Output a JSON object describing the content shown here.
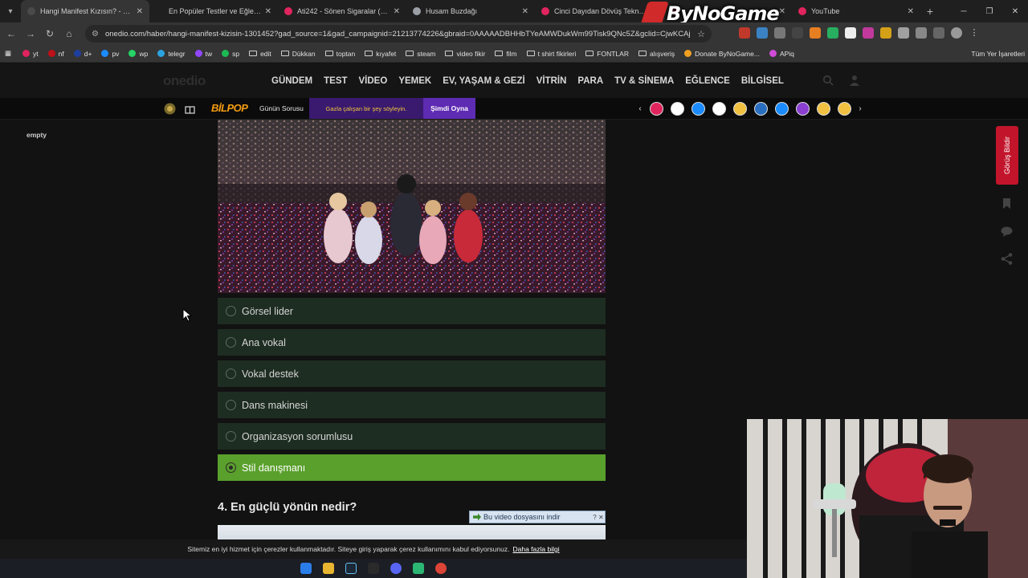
{
  "browser": {
    "tabs": [
      {
        "label": "Hangi Manifest Kızısın? - Onedio",
        "active": true,
        "fav_color": "#4a4a4a"
      },
      {
        "label": "En Popüler Testler ve Eğlenceli T",
        "active": false,
        "fav_color": "#1f1f1f"
      },
      {
        "label": "Ati242 - Sönen Sigaralar (Official",
        "active": false,
        "fav_color": "#e0245e"
      },
      {
        "label": "Husam Buzdağı",
        "active": false,
        "fav_color": "#9aa0a6"
      },
      {
        "label": "Cinci Dayıdan Dövüş Teknikleri",
        "active": false,
        "fav_color": "#e0245e"
      },
      {
        "label": "",
        "active": false,
        "fav_color": "#e0245e"
      },
      {
        "label": "YouTube",
        "active": false,
        "fav_color": "#e0245e"
      }
    ],
    "watermark_text": "ByNoGame",
    "url": "onedio.com/haber/hangi-manifest-kizisin-1301452?gad_source=1&gad_campaignid=21213774226&gbraid=0AAAAADBHHbTYeAMWDukWm99Tisk9QNc5Z&gclid=CjwKCAj...",
    "bookmarks": [
      {
        "label": "yt",
        "type": "site",
        "color": "#e0245e"
      },
      {
        "label": "nf",
        "type": "site",
        "color": "#c0101a"
      },
      {
        "label": "d+",
        "type": "site",
        "color": "#1f3f9e"
      },
      {
        "label": "pv",
        "type": "site",
        "color": "#1a8cff"
      },
      {
        "label": "wp",
        "type": "site",
        "color": "#25d366"
      },
      {
        "label": "telegr",
        "type": "site",
        "color": "#2aa3e0"
      },
      {
        "label": "tw",
        "type": "site",
        "color": "#9146ff"
      },
      {
        "label": "sp",
        "type": "site",
        "color": "#1db954"
      },
      {
        "label": "edit",
        "type": "folder"
      },
      {
        "label": "Dükkan",
        "type": "folder"
      },
      {
        "label": "toptan",
        "type": "folder"
      },
      {
        "label": "kıyafet",
        "type": "folder"
      },
      {
        "label": "steam",
        "type": "folder"
      },
      {
        "label": "video fikir",
        "type": "folder"
      },
      {
        "label": "film",
        "type": "folder"
      },
      {
        "label": "t shirt fikirleri",
        "type": "folder"
      },
      {
        "label": "FONTLAR",
        "type": "folder"
      },
      {
        "label": "alışveriş",
        "type": "folder"
      },
      {
        "label": "Donate ByNoGame...",
        "type": "site",
        "color": "#f0a020"
      },
      {
        "label": "APiq",
        "type": "site",
        "color": "#d04bd8"
      }
    ],
    "all_bookmarks_label": "Tüm Yer İşaretleri"
  },
  "site": {
    "logo": "onedio",
    "nav": [
      "GÜNDEM",
      "TEST",
      "VİDEO",
      "YEMEK",
      "EV, YAŞAM & GEZİ",
      "VİTRİN",
      "PARA",
      "TV & SİNEMA",
      "EĞLENCE",
      "BİLGİSEL"
    ],
    "bilpop": "BİLPOP",
    "gunun_sorusu": "Günün Sorusu",
    "question_text": "Gazla çalışan bir şey söyleyin.",
    "play_label": "Şimdi Oyna",
    "story_colors": [
      "#e0245e",
      "#ffffff",
      "#1a8cff",
      "#ffffff",
      "#f0c040",
      "#2a6fbf",
      "#1a8cff",
      "#8a3fd0",
      "#f0c040",
      "#f0c040"
    ]
  },
  "page": {
    "empty_label": "empty",
    "options": [
      {
        "label": "Görsel lider",
        "selected": false
      },
      {
        "label": "Ana vokal",
        "selected": false
      },
      {
        "label": "Vokal destek",
        "selected": false
      },
      {
        "label": "Dans makinesi",
        "selected": false
      },
      {
        "label": "Organizasyon sorumlusu",
        "selected": false
      },
      {
        "label": "Stil danışmanı",
        "selected": true
      }
    ],
    "next_question": "4. En güçlü yönün nedir?",
    "download_bar": "Bu video dosyasını indir",
    "download_help": "?",
    "feedback_label": "Görüş Bildir",
    "cookie_text": "Sitemiz en iyi hizmet için çerezler kullanmaktadır. Siteye giriş yaparak çerez kullanımını kabul ediyorsunuz.",
    "cookie_more": "Daha fazla bilgi"
  },
  "colors": {
    "option_bg": "#1e2d22",
    "option_selected": "#5aa02c",
    "play_button": "#5e2bb3",
    "question_bg": "#3a1a6e",
    "feedback": "#c2152b"
  }
}
